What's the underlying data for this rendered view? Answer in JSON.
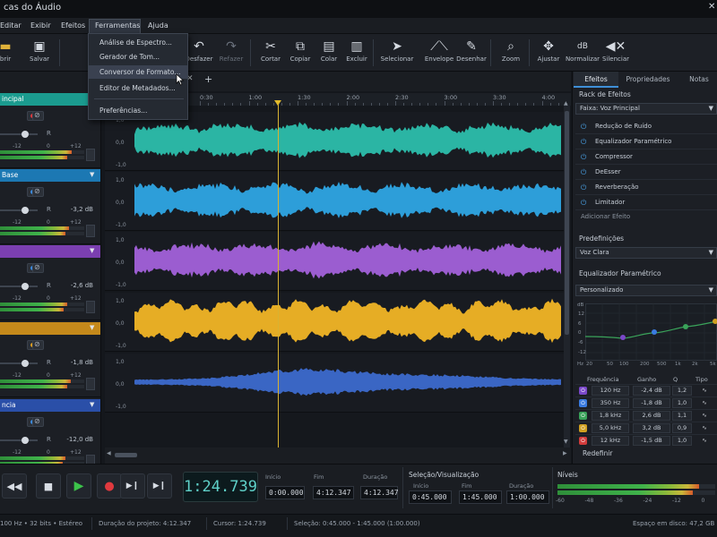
{
  "app": {
    "title": "cas do Áudio"
  },
  "menu": {
    "items": [
      "Editar",
      "Exibir",
      "Efeitos",
      "Ferramentas",
      "Ajuda"
    ]
  },
  "toolbar": {
    "buttons": [
      {
        "label": "brir",
        "icon": "folder-icon"
      },
      {
        "label": "Salvar",
        "icon": "save-icon"
      },
      {
        "label": "Desfazer",
        "icon": "undo-icon"
      },
      {
        "label": "Refazer",
        "icon": "redo-icon"
      },
      {
        "label": "Cortar",
        "icon": "scissors-icon"
      },
      {
        "label": "Copiar",
        "icon": "copy-icon"
      },
      {
        "label": "Colar",
        "icon": "paste-icon"
      },
      {
        "label": "Excluir",
        "icon": "trash-icon"
      },
      {
        "label": "Selecionar",
        "icon": "pointer-icon"
      },
      {
        "label": "Envelope",
        "icon": "envelope-icon"
      },
      {
        "label": "Desenhar",
        "icon": "pencil-icon"
      },
      {
        "label": "Zoom",
        "icon": "zoom-icon"
      },
      {
        "label": "Ajustar",
        "icon": "fit-icon"
      },
      {
        "label": "Normalizar",
        "icon": "db-icon"
      },
      {
        "label": "Silenciar",
        "icon": "mute-icon"
      }
    ],
    "dbGlyph": "dB"
  },
  "dropdown": {
    "items": [
      "Análise de Espectro...",
      "Gerador de Tom...",
      "Conversor de Formato...",
      "Editor de Metadados...",
      "Preferências..."
    ],
    "highlighted": 2
  },
  "tracks": [
    {
      "name": "incipal",
      "color": "#1b9b8f",
      "db": "",
      "scaleL": "-12",
      "scaleM": "0",
      "scaleR": "+12",
      "recColor": "#e0393e",
      "levels": [
        0.85,
        0.8
      ]
    },
    {
      "name": "Base",
      "color": "#1c78b3",
      "db": "-3,2 dB",
      "scaleL": "-12",
      "scaleM": "0",
      "scaleR": "+12",
      "recColor": "#3b8be0",
      "levels": [
        0.82,
        0.78
      ]
    },
    {
      "name": "",
      "color": "#7b3fb0",
      "db": "-2,6 dB",
      "scaleL": "-12",
      "scaleM": "0",
      "scaleR": "+12",
      "recColor": "#3b8be0",
      "levels": [
        0.8,
        0.76
      ]
    },
    {
      "name": "",
      "color": "#c4891b",
      "db": "-1,8 dB",
      "scaleL": "-12",
      "scaleM": "0",
      "scaleR": "+12",
      "recColor": "#e0a020",
      "levels": [
        0.84,
        0.8
      ]
    },
    {
      "name": "ncia",
      "color": "#2a4fa8",
      "db": "-12,0 dB",
      "scaleL": "-12",
      "scaleM": "0",
      "scaleR": "+12",
      "recColor": "#3b8be0",
      "levels": [
        0.78,
        0.74
      ]
    }
  ],
  "trackRLabel": "R",
  "ruler": {
    "ticks": [
      "0:30",
      "1:00",
      "1:30",
      "2:00",
      "2:30",
      "3:00",
      "3:30",
      "4:00"
    ]
  },
  "lanes": [
    {
      "color": "#2bb5a4",
      "labels": [
        "1,0",
        "0,0",
        "-1,0"
      ]
    },
    {
      "color": "#2d9ed9",
      "labels": [
        "1,0",
        "0,0",
        "-1,0"
      ]
    },
    {
      "color": "#9b5dd0",
      "labels": [
        "1,0",
        "0,0",
        "-1,0"
      ]
    },
    {
      "color": "#e6ad25",
      "labels": [
        "1,0",
        "0,0",
        "-1,0"
      ]
    },
    {
      "color": "#3a66c4",
      "labels": [
        "1,0",
        "0,0",
        "-1,0"
      ]
    }
  ],
  "playhead": {
    "time": "1:24.739"
  },
  "rightPanel": {
    "tabs": [
      "Efeitos",
      "Propriedades",
      "Notas"
    ],
    "rackTitle": "Rack de Efeitos",
    "trackSelect": "Faixa: Voz Principal",
    "effects": [
      "Redução de Ruído",
      "Equalizador Paramétrico",
      "Compressor",
      "DeEsser",
      "Reverberação",
      "Limitador"
    ],
    "addEffect": "Adicionar Efeito",
    "presetsTitle": "Predefinições",
    "preset": "Voz Clara",
    "eqTitle": "Equalizador Paramétrico",
    "eqPreset": "Personalizado",
    "eqYLabels": [
      "dB",
      "12",
      "6",
      "0",
      "-6",
      "-12"
    ],
    "eqXLabels": [
      "Hz",
      "20",
      "50",
      "100",
      "200",
      "500",
      "1k",
      "2k",
      "5k"
    ],
    "eqHeaders": [
      "Frequência",
      "Ganho",
      "Q",
      "Tipo"
    ],
    "eqBands": [
      {
        "freq": "120 Hz",
        "gain": "-2,4 dB",
        "q": "1,2",
        "color": "#7a48c9"
      },
      {
        "freq": "350 Hz",
        "gain": "-1,8 dB",
        "q": "1,0",
        "color": "#3a7be0"
      },
      {
        "freq": "1,8 kHz",
        "gain": "2,6 dB",
        "q": "1,1",
        "color": "#3aa35a"
      },
      {
        "freq": "5,0 kHz",
        "gain": "3,2 dB",
        "q": "0,9",
        "color": "#d0a020"
      },
      {
        "freq": "12 kHz",
        "gain": "-1,5 dB",
        "q": "1,0",
        "color": "#d23c3c"
      }
    ],
    "redefine": "Redefinir"
  },
  "transport": {
    "time": "1:24.739",
    "start": {
      "label": "Início",
      "value": "0:00.000"
    },
    "end": {
      "label": "Fim",
      "value": "4:12.347"
    },
    "duration": {
      "label": "Duração",
      "value": "4:12.347"
    },
    "selTitle": "Seleção/Visualização",
    "selStart": {
      "label": "Início",
      "value": "0:45.000"
    },
    "selEnd": {
      "label": "Fim",
      "value": "1:45.000"
    },
    "selDur": {
      "label": "Duração",
      "value": "1:00.000"
    },
    "levelsTitle": "Níveis",
    "levelsScale": [
      "-60",
      "-48",
      "-36",
      "-24",
      "-12",
      "0"
    ],
    "levels": [
      0.9,
      0.86
    ]
  },
  "status": {
    "format": "100 Hz • 32 bits • Estéreo",
    "projectDuration": "Duração do projeto: 4:12.347",
    "cursor": "Cursor: 1:24.739",
    "selection": "Seleção: 0:45.000 - 1:45.000 (1:00.000)",
    "disk": "Espaço em disco: 47,2 GB"
  }
}
